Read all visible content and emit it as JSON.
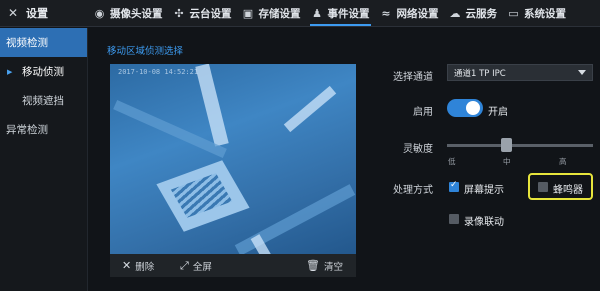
{
  "header": {
    "title": "设置",
    "tabs": [
      {
        "label": "摄像头设置",
        "icon": "camera-icon"
      },
      {
        "label": "云台设置",
        "icon": "move-arrows-icon"
      },
      {
        "label": "存储设置",
        "icon": "storage-icon"
      },
      {
        "label": "事件设置",
        "icon": "bell-icon",
        "active": true
      },
      {
        "label": "网络设置",
        "icon": "wifi-icon"
      },
      {
        "label": "云服务",
        "icon": "cloud-icon"
      },
      {
        "label": "系统设置",
        "icon": "monitor-icon"
      }
    ]
  },
  "sidebar": {
    "items": [
      {
        "label": "视频检测"
      },
      {
        "label": "移动侦测"
      },
      {
        "label": "视频遮挡"
      },
      {
        "label": "异常检测"
      }
    ]
  },
  "main": {
    "section_title": "移动区域侦测选择",
    "video": {
      "timestamp": "2017-10-08 14:52:21"
    },
    "video_actions": {
      "delete": "删除",
      "fullscreen": "全屏",
      "clear": "清空"
    },
    "form": {
      "channel_label": "选择通道",
      "channel_value": "通道1 TP IPC",
      "enable_label": "启用",
      "enable_value": "开启",
      "sensitivity_label": "灵敏度",
      "sensitivity_ticks": [
        "低",
        "中",
        "高"
      ],
      "sensitivity_value": "中",
      "action_label": "处理方式",
      "screen_prompt": "屏幕提示",
      "buzzer": "蜂鸣器",
      "record_link": "录像联动"
    },
    "checkbox_state": {
      "screen_prompt": true,
      "buzzer": false,
      "record_link": false
    },
    "colors": {
      "accent": "#3d9bf0",
      "highlight": "#e7e53c"
    }
  }
}
